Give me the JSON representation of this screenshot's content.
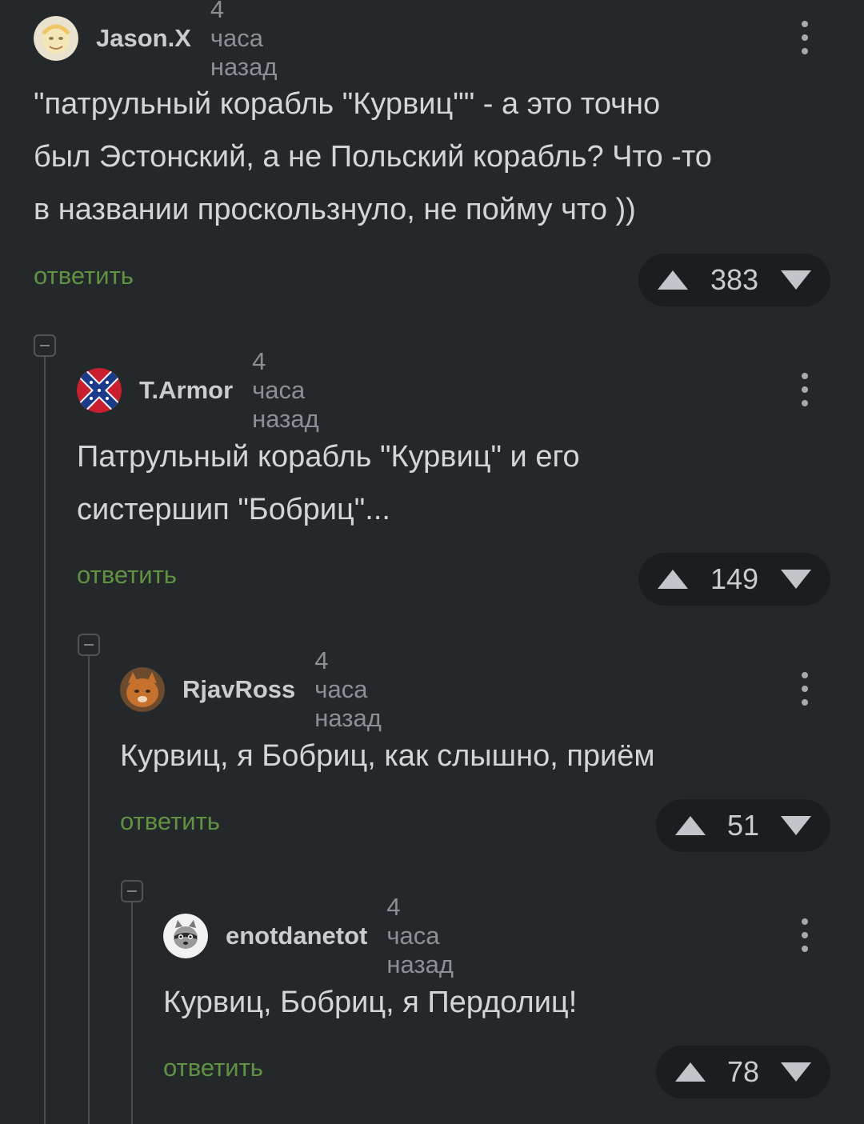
{
  "comments": [
    {
      "username": "Jason.X",
      "time": "4 часа назад",
      "text": "\"патрульный корабль \"Курвиц\"\" - а это точно\nбыл Эстонский, а не Польский корабль? Что -то\nв названии проскользнуло, не пойму что ))",
      "reply": "ответить",
      "votes": "383",
      "avatar_icon": "avatar-cartoon-icon"
    },
    {
      "username": "T.Armor",
      "time": "4 часа назад",
      "text": "Патрульный корабль \"Курвиц\" и его\nсистершип \"Бобриц\"...",
      "reply": "ответить",
      "votes": "149",
      "avatar_icon": "avatar-flag-icon"
    },
    {
      "username": "RjavRoss",
      "time": "4 часа назад",
      "text": "Курвиц, я Бобриц, как слышно, приём",
      "reply": "ответить",
      "votes": "51",
      "avatar_icon": "avatar-cat-icon"
    },
    {
      "username": "enotdanetot",
      "time": "4 часа назад",
      "text": "Курвиц, Бобриц, я Пердолиц!",
      "reply": "ответить",
      "votes": "78",
      "avatar_icon": "avatar-raccoon-icon"
    }
  ],
  "colors": {
    "background": "#25282b",
    "reply_link": "#5f9241",
    "vote_pill": "#1b1d1f",
    "thread_line": "#4a4e52"
  }
}
